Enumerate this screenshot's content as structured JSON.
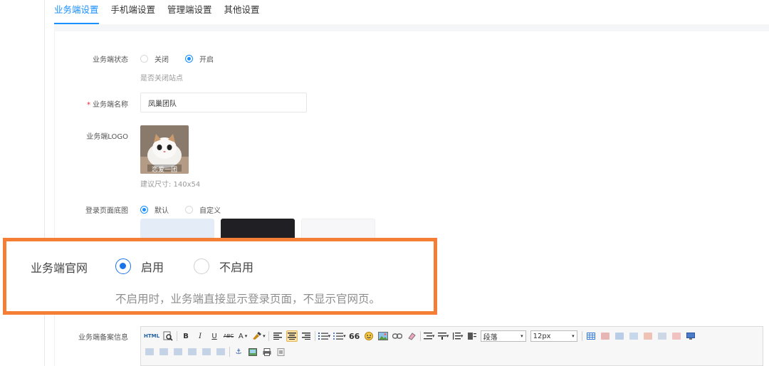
{
  "tabs": [
    {
      "label": "业务端设置",
      "active": true
    },
    {
      "label": "手机端设置",
      "active": false
    },
    {
      "label": "管理端设置",
      "active": false
    },
    {
      "label": "其他设置",
      "active": false
    }
  ],
  "form": {
    "status": {
      "label": "业务端状态",
      "options": [
        "关闭",
        "开启"
      ],
      "selected": "开启",
      "hint": "是否关闭站点"
    },
    "name": {
      "label": "业务端名称",
      "value": "凤巢团队"
    },
    "logo": {
      "label": "业务端LOGO",
      "caption": "恋爱一团",
      "hint": "建议尺寸: 140x54"
    },
    "login_bg": {
      "label": "登录页面底图",
      "options": [
        "默认",
        "自定义"
      ],
      "selected": "默认"
    },
    "website": {
      "label": "业务端官网",
      "options": [
        "启用",
        "不启用"
      ],
      "selected": "启用",
      "hint": "不启用时，业务端直接显示登录页面，不显示官网页。"
    },
    "icp": {
      "label": "业务端备案信息"
    }
  },
  "editor": {
    "html_label": "HTML",
    "bold": "B",
    "italic": "I",
    "underline": "U",
    "strike": "ABC",
    "fontcolor": "A",
    "quote": "66",
    "paragraph": "段落",
    "fontsize": "12px"
  },
  "colors": {
    "accent": "#1890ff",
    "callout_border": "#f47e36",
    "required": "#f5222d"
  }
}
